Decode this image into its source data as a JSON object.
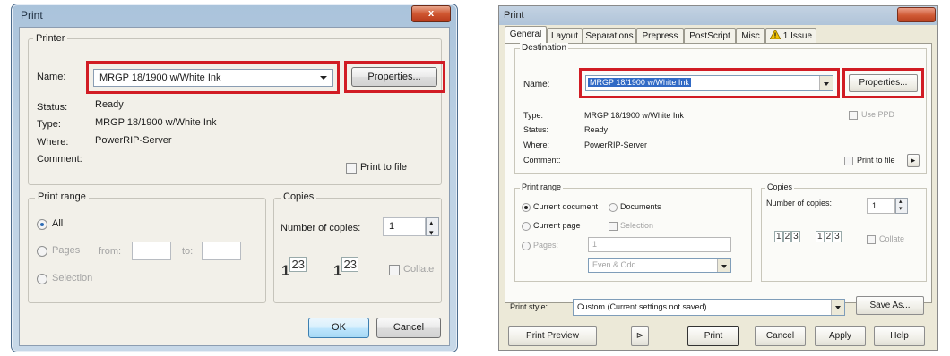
{
  "left_dialog": {
    "title": "Print",
    "close_glyph": "x",
    "printer_group_label": "Printer",
    "name_label": "Name:",
    "printer_name": "MRGP 18/1900 w/White Ink",
    "properties_button": "Properties...",
    "status_label": "Status:",
    "status_value": "Ready",
    "type_label": "Type:",
    "type_value": "MRGP 18/1900 w/White Ink",
    "where_label": "Where:",
    "where_value": "PowerRIP-Server",
    "comment_label": "Comment:",
    "print_to_file_label": "Print to file",
    "print_range_label": "Print range",
    "all_label": "All",
    "pages_label": "Pages",
    "from_label": "from:",
    "to_label": "to:",
    "selection_label": "Selection",
    "copies_label": "Copies",
    "number_of_copies_label": "Number of copies:",
    "copies_value": "1",
    "collate_label": "Collate",
    "collate_icon_sup": "23",
    "collate_icon_base": "1",
    "ok_button": "OK",
    "cancel_button": "Cancel"
  },
  "right_dialog": {
    "title": "Print",
    "tabs": [
      "General",
      "Layout",
      "Separations",
      "Prepress",
      "PostScript",
      "Misc",
      "1 Issue"
    ],
    "destination_label": "Destination",
    "name_label": "Name:",
    "printer_name": "MRGP 18/1900 w/White Ink",
    "properties_button": "Properties...",
    "type_label": "Type:",
    "type_value": "MRGP 18/1900 w/White Ink",
    "status_label": "Status:",
    "status_value": "Ready",
    "where_label": "Where:",
    "where_value": "PowerRIP-Server",
    "comment_label": "Comment:",
    "use_ppd_label": "Use PPD",
    "print_to_file_label": "Print to file",
    "print_range_label": "Print range",
    "current_document_label": "Current document",
    "documents_label": "Documents",
    "current_page_label": "Current page",
    "selection_label": "Selection",
    "pages_label": "Pages:",
    "pages_value": "1",
    "even_odd_value": "Even & Odd",
    "copies_label": "Copies",
    "number_of_copies_label": "Number of copies:",
    "copies_value": "1",
    "collate_label": "Collate",
    "print_style_label": "Print style:",
    "print_style_value": "Custom (Current settings not saved)",
    "save_as_button": "Save As...",
    "print_preview_button": "Print Preview",
    "preview_arrow_glyph": "⊳",
    "print_button": "Print",
    "cancel_button": "Cancel",
    "apply_button": "Apply",
    "help_button": "Help"
  },
  "colors": {
    "highlight_red": "#d11c24",
    "vista_frame": "#bcd1e4",
    "classic_face": "#ece9d8",
    "selection_blue": "#316ac5"
  },
  "icons": [
    "close-icon",
    "dropdown-arrow-icon",
    "spin-arrows-icon",
    "collate-pages-icon",
    "warning-icon"
  ]
}
